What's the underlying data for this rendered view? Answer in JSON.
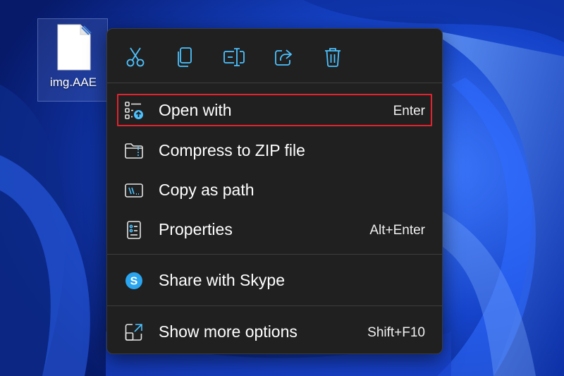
{
  "desktop": {
    "file_label": "img.AAE"
  },
  "toolbar": {
    "buttons": [
      {
        "icon": "scissors-icon",
        "action": "cut"
      },
      {
        "icon": "copy-icon",
        "action": "copy"
      },
      {
        "icon": "rename-icon",
        "action": "rename"
      },
      {
        "icon": "share-icon",
        "action": "share"
      },
      {
        "icon": "trash-icon",
        "action": "delete"
      }
    ]
  },
  "menu": {
    "items": [
      {
        "label": "Open with",
        "shortcut": "Enter",
        "icon": "open-with-icon",
        "highlighted": true
      },
      {
        "label": "Compress to ZIP file",
        "shortcut": "",
        "icon": "zip-folder-icon"
      },
      {
        "label": "Copy as path",
        "shortcut": "",
        "icon": "copy-path-icon"
      },
      {
        "label": "Properties",
        "shortcut": "Alt+Enter",
        "icon": "properties-icon"
      },
      {
        "label": "Share with Skype",
        "shortcut": "",
        "icon": "skype-icon"
      },
      {
        "label": "Show more options",
        "shortcut": "Shift+F10",
        "icon": "show-more-icon"
      }
    ]
  },
  "colors": {
    "accent": "#4cc2ff",
    "menu_bg": "#202020",
    "highlight_border": "#e0232e",
    "wallpaper_blue": "#1a4bd6"
  }
}
